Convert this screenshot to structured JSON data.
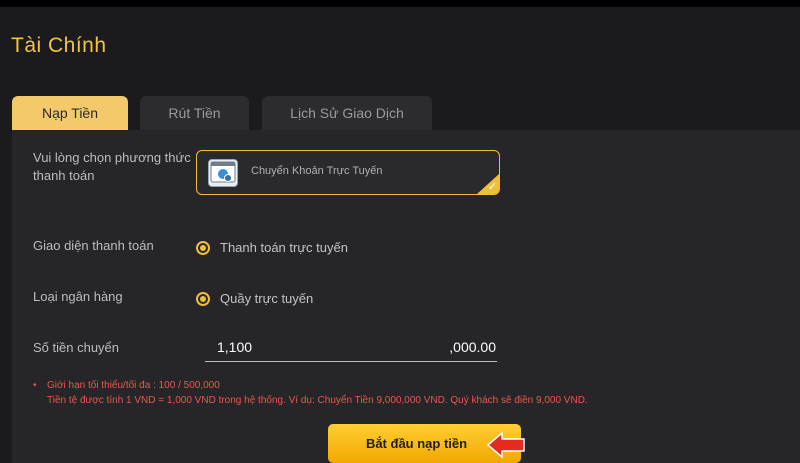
{
  "page": {
    "title": "Tài Chính"
  },
  "tabs": [
    {
      "label": "Nạp Tiền",
      "active": true
    },
    {
      "label": "Rút Tiền",
      "active": false
    },
    {
      "label": "Lịch Sử Giao Dịch",
      "active": false
    }
  ],
  "form": {
    "method_label_line1": "Vui lòng chọn phương thức",
    "method_label_line2": "thanh toán",
    "method_option": "Chuyển Khoản Trực Tuyến",
    "interface_label": "Giao diện thanh toán",
    "interface_option": "Thanh toán trực tuyến",
    "bank_label": "Loại ngân hàng",
    "bank_option": "Quầy trực tuyến",
    "amount_label": "Số tiền chuyển",
    "amount_value": "1,100",
    "amount_suffix": ",000.00"
  },
  "notes": {
    "line1": "Giới hạn tối thiểu/tối đa : 100 / 500,000",
    "line2": "Tiền tệ được tính 1 VND = 1,000 VND trong hệ thống. Ví dụ: Chuyển Tiền 9,000,000 VND. Quý khách sẽ điền 9,000 VND."
  },
  "submit": {
    "label": "Bắt đầu nạp tiền"
  },
  "colors": {
    "accent": "#f0bf3a",
    "title": "#f3c43c",
    "warning": "#e85a4a",
    "background": "#1b1b1d"
  },
  "icons": {
    "method": "bank-transfer-icon",
    "check": "check-icon",
    "pointer": "arrow-pointer-icon"
  }
}
